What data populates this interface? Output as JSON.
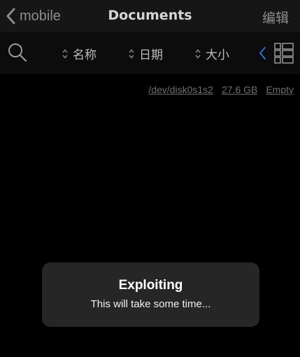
{
  "navbar": {
    "back_label": "mobile",
    "title": "Documents",
    "edit_label": "编辑"
  },
  "toolbar": {
    "search_icon": "search-icon",
    "sort_options": [
      {
        "label": "名称"
      },
      {
        "label": "日期"
      },
      {
        "label": "大小"
      }
    ],
    "collapse_icon": "chevron-left-icon",
    "view_icon": "grid-view-icon"
  },
  "disk_info": {
    "device": "/dev/disk0s1s2",
    "size": "27.6 GB",
    "status": "Empty"
  },
  "toast": {
    "title": "Exploiting",
    "message": "This will take some time..."
  },
  "colors": {
    "background": "#000000",
    "navbar": "#161616",
    "toast": "#262626",
    "accent": "#2f6fd6"
  }
}
